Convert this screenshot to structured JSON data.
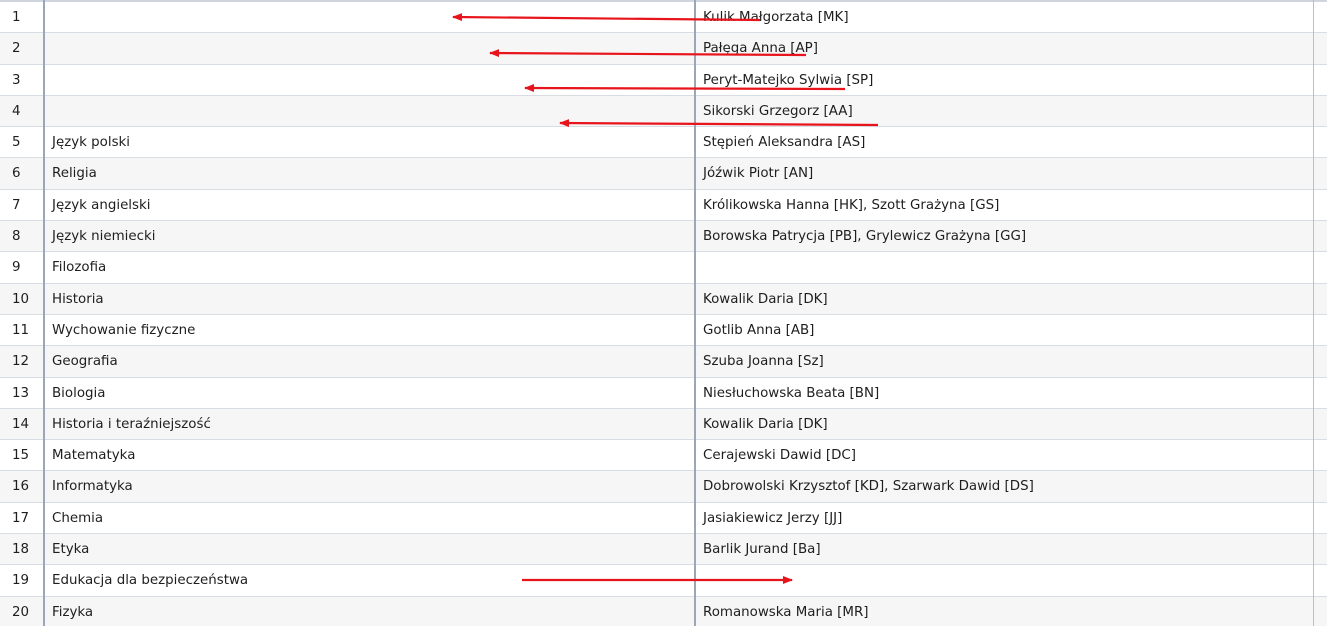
{
  "rows": [
    {
      "num": "1",
      "subject": "",
      "teacher": "Kulik Małgorzata [MK]"
    },
    {
      "num": "2",
      "subject": "",
      "teacher": "Pałęga Anna [AP]"
    },
    {
      "num": "3",
      "subject": "",
      "teacher": "Peryt-Matejko Sylwia [SP]"
    },
    {
      "num": "4",
      "subject": "",
      "teacher": "Sikorski Grzegorz [AA]"
    },
    {
      "num": "5",
      "subject": "Język polski",
      "teacher": "Stępień Aleksandra [AS]"
    },
    {
      "num": "6",
      "subject": "Religia",
      "teacher": "Jóźwik Piotr [AN]"
    },
    {
      "num": "7",
      "subject": "Język angielski",
      "teacher": "Królikowska Hanna [HK], Szott Grażyna [GS]"
    },
    {
      "num": "8",
      "subject": "Język niemiecki",
      "teacher": "Borowska Patrycja [PB], Grylewicz Grażyna [GG]"
    },
    {
      "num": "9",
      "subject": "Filozofia",
      "teacher": ""
    },
    {
      "num": "10",
      "subject": "Historia",
      "teacher": "Kowalik Daria [DK]"
    },
    {
      "num": "11",
      "subject": "Wychowanie fizyczne",
      "teacher": "Gotlib Anna [AB]"
    },
    {
      "num": "12",
      "subject": "Geografia",
      "teacher": "Szuba Joanna [Sz]"
    },
    {
      "num": "13",
      "subject": "Biologia",
      "teacher": "Niesłuchowska Beata [BN]"
    },
    {
      "num": "14",
      "subject": "Historia i teraźniejszość",
      "teacher": "Kowalik Daria [DK]"
    },
    {
      "num": "15",
      "subject": "Matematyka",
      "teacher": "Cerajewski Dawid [DC]"
    },
    {
      "num": "16",
      "subject": "Informatyka",
      "teacher": "Dobrowolski Krzysztof [KD], Szarwark Dawid [DS]"
    },
    {
      "num": "17",
      "subject": "Chemia",
      "teacher": "Jasiakiewicz Jerzy [JJ]"
    },
    {
      "num": "18",
      "subject": "Etyka",
      "teacher": "Barlik Jurand [Ba]"
    },
    {
      "num": "19",
      "subject": "Edukacja dla bezpieczeństwa",
      "teacher": ""
    },
    {
      "num": "20",
      "subject": "Fizyka",
      "teacher": "Romanowska Maria [MR]"
    }
  ],
  "annotation_color": "#e8141b"
}
